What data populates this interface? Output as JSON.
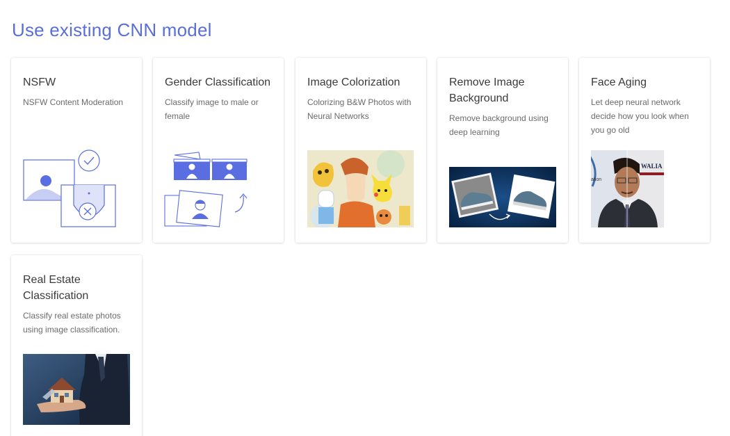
{
  "page": {
    "title": "Use existing CNN model"
  },
  "cards": [
    {
      "title": "NSFW",
      "description": "NSFW Content Moderation",
      "image": "content-moderation-illustration"
    },
    {
      "title": "Gender Classification",
      "description": "Classify image to male or female",
      "image": "gender-classification-illustration"
    },
    {
      "title": "Image Colorization",
      "description": "Colorizing B&W Photos with Neural Networks",
      "image": "colorized-cartoon-photo"
    },
    {
      "title": "Remove Image Background",
      "description": "Remove background using deep learning",
      "image": "sneaker-background-removal-photo"
    },
    {
      "title": "Face Aging",
      "description": "Let deep neural network decide how you look when you go old",
      "image": "face-aging-photo",
      "image_text": "WALIA",
      "image_subtext": "ation"
    },
    {
      "title": "Real Estate Classification",
      "description": "Classify real estate photos using image classification.",
      "image": "house-in-hand-photo"
    }
  ],
  "colors": {
    "accent": "#5a6fd6",
    "illustration": "#5b6ee1",
    "card_title": "#3a3a3a",
    "card_text": "#6b6b6b"
  }
}
